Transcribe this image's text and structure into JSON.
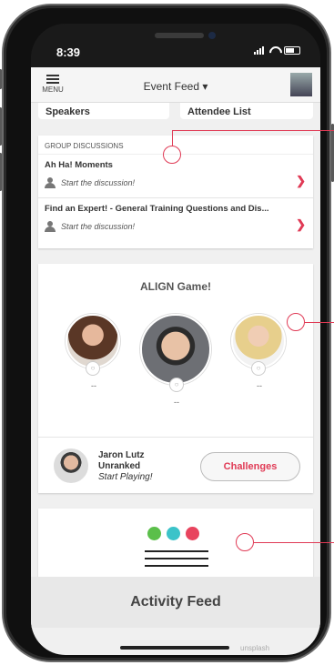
{
  "status": {
    "time": "8:39"
  },
  "header": {
    "menu_label": "MENU",
    "title": "Event Feed ▾"
  },
  "tiles": {
    "speakers": "Speakers",
    "attendees": "Attendee List"
  },
  "group_discussions": {
    "heading": "GROUP DISCUSSIONS",
    "items": [
      {
        "title": "Ah Ha! Moments",
        "sub": "Start the discussion!"
      },
      {
        "title": "Find an Expert! - General Training Questions and Dis...",
        "sub": "Start the discussion!"
      }
    ]
  },
  "game": {
    "title": "ALIGN Game!",
    "ranks": [
      "--",
      "--",
      "--"
    ],
    "player": {
      "name": "Jaron Lutz",
      "rank": "Unranked",
      "cta": "Start Playing!"
    },
    "challenge_button": "Challenges"
  },
  "activity": {
    "label": "Activity Feed",
    "dot_colors": [
      "#5bbf4a",
      "#3bc3c9",
      "#e8445e"
    ]
  },
  "watermark": "unsplash",
  "colors": {
    "accent": "#e03a55"
  }
}
